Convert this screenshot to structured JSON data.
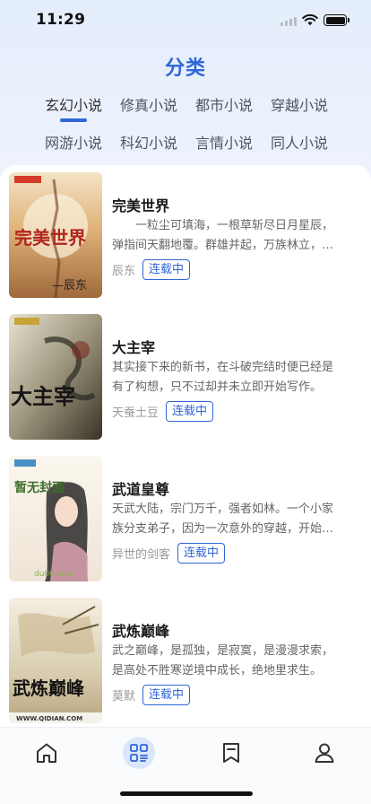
{
  "status_bar": {
    "time": "11:29"
  },
  "page": {
    "title": "分类"
  },
  "categories": [
    {
      "label": "玄幻小说",
      "active": true
    },
    {
      "label": "修真小说",
      "active": false
    },
    {
      "label": "都市小说",
      "active": false
    },
    {
      "label": "穿越小说",
      "active": false
    },
    {
      "label": "网游小说",
      "active": false
    },
    {
      "label": "科幻小说",
      "active": false
    },
    {
      "label": "言情小说",
      "active": false
    },
    {
      "label": "同人小说",
      "active": false
    }
  ],
  "books": [
    {
      "title": "完美世界",
      "description": "　　一粒尘可填海，一根草斩尽日月星辰，弹指间天翻地覆。群雄并起，万族林立，诸圣争霸，乱天动地。",
      "author": "辰东",
      "status": "连载中",
      "cover_text": "完美世界",
      "cover_sub": "—辰东"
    },
    {
      "title": "大主宰",
      "description": "其实接下来的新书，在斗破完结时便已经是有了构想，只不过却并未立即开始写作。",
      "author": "天蚕土豆",
      "status": "连载中",
      "cover_text": "大主宰"
    },
    {
      "title": "武道皇尊",
      "description": "天武大陆，宗门万千，强者如林。一个小家族分支弟子，因为一次意外的穿越，开始了传奇的一生。",
      "author": "异世的剑客",
      "status": "连载中",
      "cover_text": "暂无封面",
      "cover_sub": "du00.com"
    },
    {
      "title": "武炼巅峰",
      "description": "武之巅峰，是孤独，是寂寞，是漫漫求索，是高处不胜寒逆境中成长，绝地里求生。",
      "author": "莫默",
      "status": "连载中",
      "cover_text": "武炼巅峰",
      "cover_sub": "WWW.QIDIAN.COM"
    }
  ],
  "tabbar": [
    {
      "name": "home",
      "icon": "home-icon",
      "active": false
    },
    {
      "name": "category",
      "icon": "category-icon",
      "active": true
    },
    {
      "name": "bookshelf",
      "icon": "bookmark-icon",
      "active": false
    },
    {
      "name": "profile",
      "icon": "user-icon",
      "active": false
    }
  ],
  "colors": {
    "accent": "#2f66d8",
    "active_tab_bg": "#dbe6fb"
  }
}
